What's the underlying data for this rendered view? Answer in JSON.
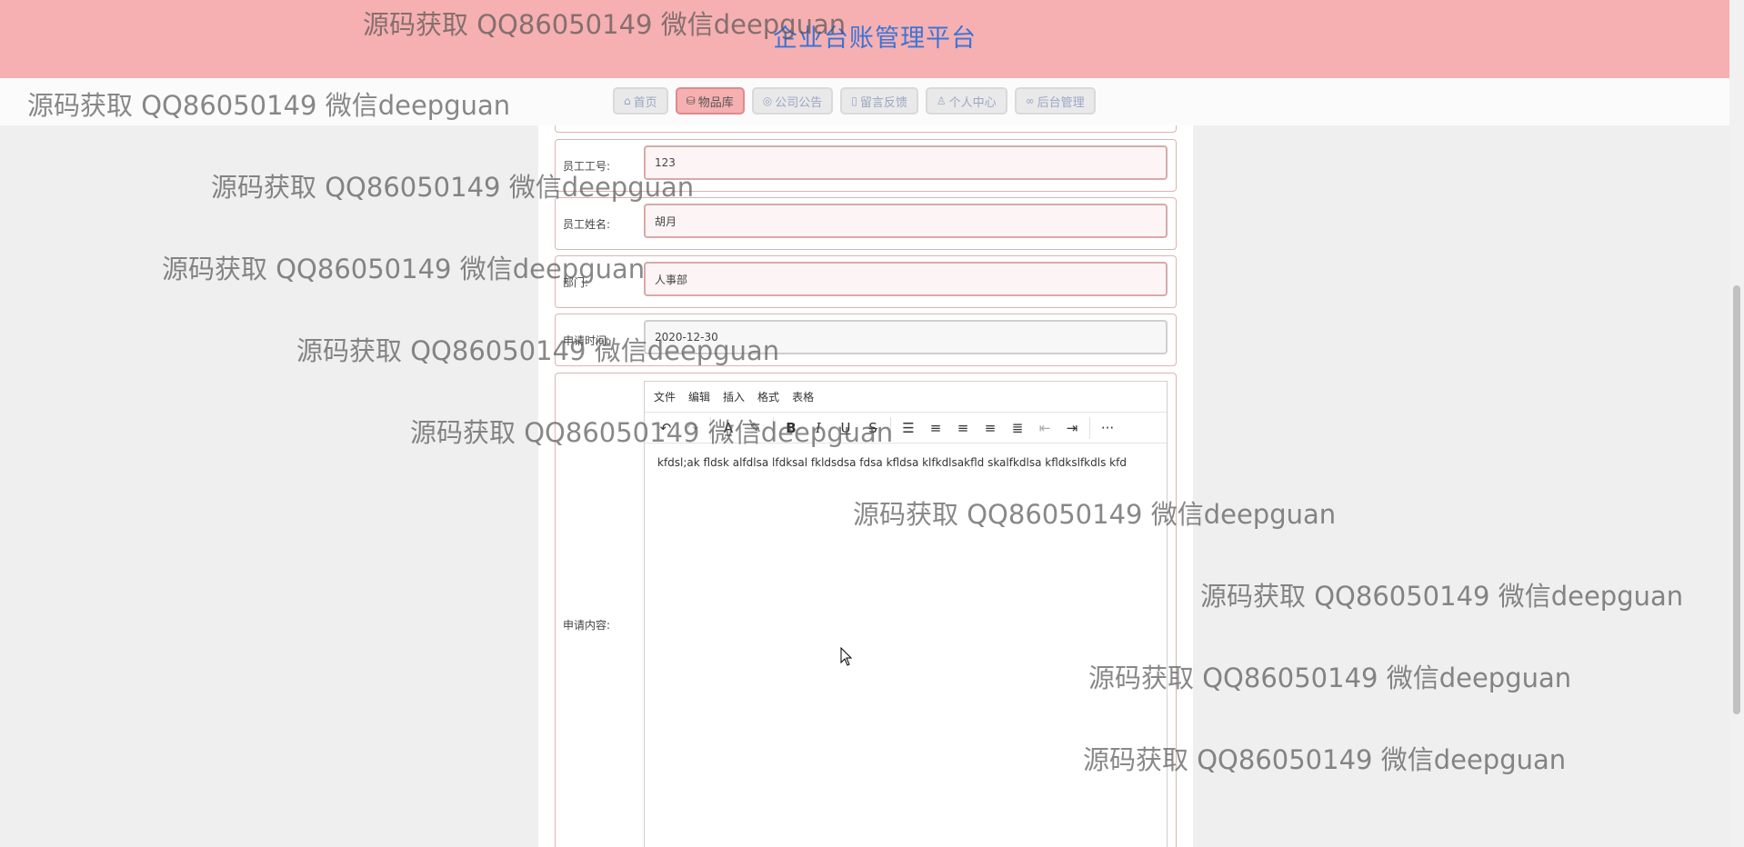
{
  "header": {
    "title": "企业台账管理平台"
  },
  "nav": {
    "items": [
      {
        "label": "首页",
        "icon": "home-icon",
        "active": false
      },
      {
        "label": "物品库",
        "icon": "database-icon",
        "active": true
      },
      {
        "label": "公司公告",
        "icon": "chat-icon",
        "active": false
      },
      {
        "label": "留言反馈",
        "icon": "note-icon",
        "active": false
      },
      {
        "label": "个人中心",
        "icon": "user-icon",
        "active": false
      },
      {
        "label": "后台管理",
        "icon": "link-icon",
        "active": false
      }
    ]
  },
  "form": {
    "employee_id": {
      "label": "员工工号:",
      "value": "123"
    },
    "employee_name": {
      "label": "员工姓名:",
      "value": "胡月"
    },
    "department": {
      "label": "部门:",
      "value": "人事部"
    },
    "apply_time": {
      "label": "申请时间:",
      "value": "2020-12-30"
    },
    "content": {
      "label": "申请内容:"
    }
  },
  "editor": {
    "menus": [
      "文件",
      "编辑",
      "插入",
      "格式",
      "表格"
    ],
    "content": "kfdsl;ak fldsk alfdlsa lfdksal fkldsdsa fdsa kfldsa klfkdlsakfld skalfkdlsa kfldkslfkdls kfd"
  },
  "watermark": "源码获取 QQ86050149 微信deepguan",
  "colors": {
    "banner": "#f6b0b1",
    "title": "#3c74d6",
    "active_nav": "#f6b0b1"
  }
}
